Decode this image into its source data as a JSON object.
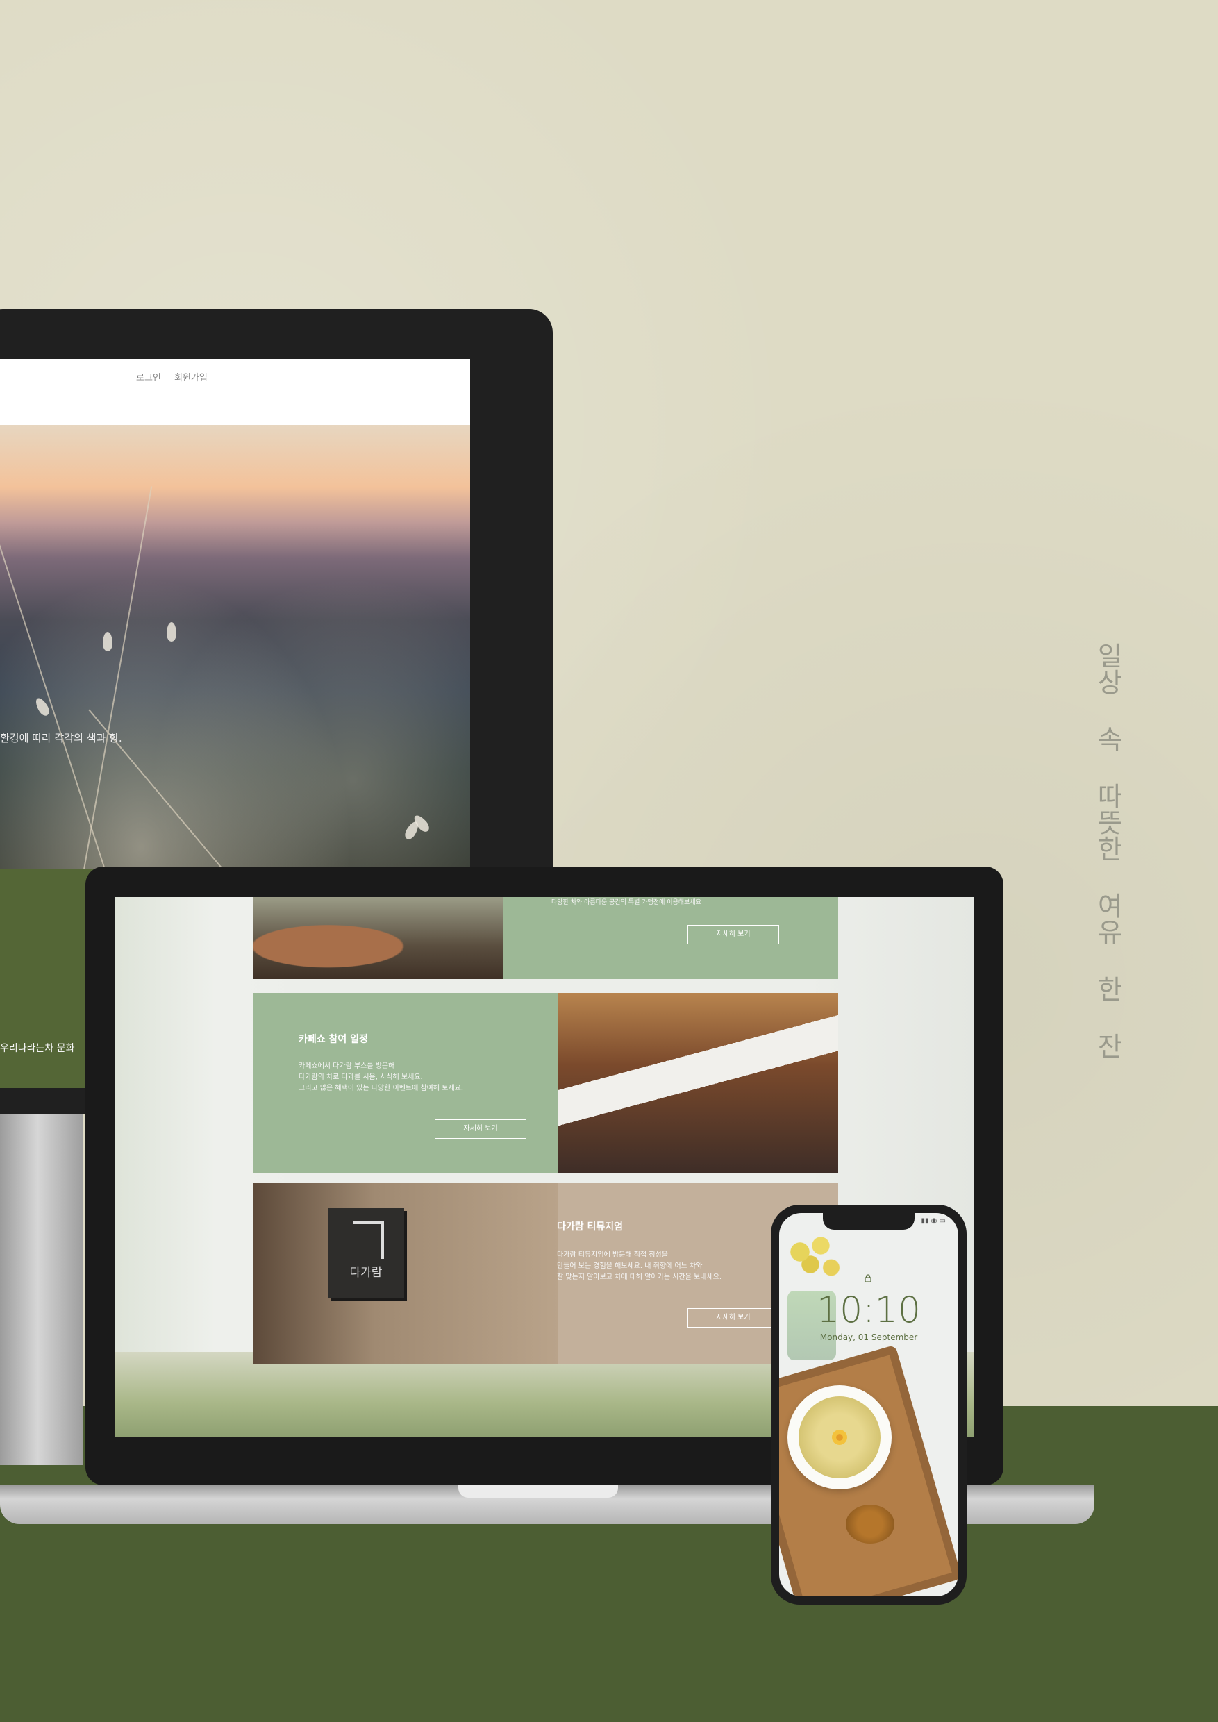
{
  "tagline": "일상 속 따뜻한 여유 한 잔",
  "monitor": {
    "nav": {
      "login": "로그인",
      "signup": "회원가입"
    },
    "hero_caption": "환경에 따라 각각의 색과 향.",
    "footer_caption": "우리나라는차 문화"
  },
  "laptop": {
    "card_1": {
      "body_fragment": "다양한 차와 아름다운 공간의 특별 가맹점에 이용해보세요",
      "button": "자세히 보기"
    },
    "card_2": {
      "title": "카페쇼 참여 일정",
      "body": [
        "카페쇼에서 다가람 부스를 방문해",
        "다가람의 차로 다과를 시음, 시식해 보세요.",
        "그리고 많은 혜택이 있는 다양한 이벤트에 참여해 보세요."
      ],
      "button": "자세히 보기"
    },
    "card_3": {
      "title": "다가람 티뮤지엄",
      "sign_text": "다가람",
      "body": [
        "다가람 티뮤지엄에 방문해 직접 정성을",
        "만들어 보는 경험을 해보세요. 내 취향에 어느 차와",
        "잘 맞는지 알아보고 차에 대해 알아가는 시간을 보내세요."
      ],
      "button": "자세히 보기"
    }
  },
  "phone": {
    "time": "10:10",
    "date": "Monday, 01 September"
  },
  "colors": {
    "background_paper": "#dedbc5",
    "floor_green": "#4c5e33",
    "card_green": "#9db896",
    "card_beige": "#c3b09b",
    "phone_text_green": "#5d7043"
  }
}
